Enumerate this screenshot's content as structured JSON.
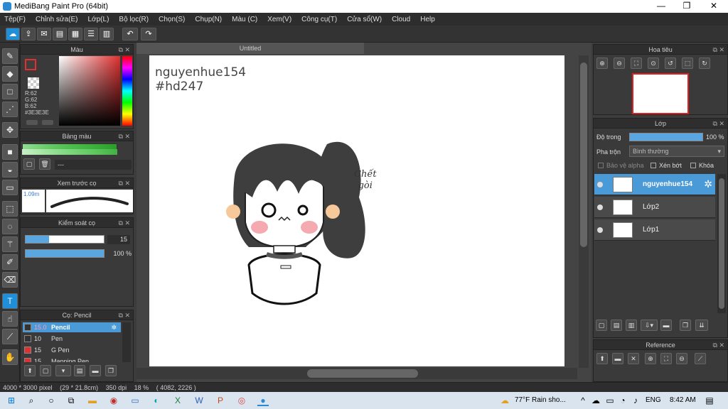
{
  "app": {
    "title": "MediBang Paint Pro (64bit)"
  },
  "window_controls": {
    "minimize": "—",
    "maximize": "❐",
    "close": "✕"
  },
  "menu": [
    "Tệp(F)",
    "Chỉnh sửa(E)",
    "Lớp(L)",
    "Bộ lọc(R)",
    "Chọn(S)",
    "Chụp(N)",
    "Màu (C)",
    "Xem(V)",
    "Công cụ(T)",
    "Cửa sổ(W)",
    "Cloud",
    "Help"
  ],
  "document": {
    "tab_title": "Untitled",
    "canvas_text_line1": "nguyenhue154",
    "canvas_text_line2": "#hd247",
    "sticker_text_1": "Chết",
    "sticker_text_2": "gòi"
  },
  "color_panel": {
    "title": "Màu",
    "r": "R:62",
    "g": "G:62",
    "b": "B:62",
    "hex": "#3E3E3E",
    "accent": "#e03030"
  },
  "palette_panel": {
    "title": "Bảng màu",
    "label": "---"
  },
  "brush_preview": {
    "title": "Xem trước cọ",
    "size": "1.09m"
  },
  "brush_control": {
    "title": "Kiểm soát cọ",
    "size_value": "15",
    "opacity_value": "100 %"
  },
  "brush_list": {
    "title": "Cọ: Pencil",
    "items": [
      {
        "size": "15.0",
        "name": "Pencil",
        "color": "#333333"
      },
      {
        "size": "10",
        "name": "Pen",
        "color": "#333333"
      },
      {
        "size": "15",
        "name": "G Pen",
        "color": "#e03030"
      },
      {
        "size": "15",
        "name": "Mapping Pen",
        "color": "#e03030"
      }
    ]
  },
  "navigator": {
    "title": "Hoa tiêu"
  },
  "layer_panel": {
    "title": "Lớp",
    "opacity_label": "Độ trong",
    "opacity_value": "100 %",
    "blend_label": "Pha trộn",
    "blend_value": "Bình thường",
    "protect_alpha": "Bảo vệ alpha",
    "clipping": "Xén bớt",
    "lock": "Khóa",
    "layers": [
      {
        "name": "nguyenhue154",
        "selected": true
      },
      {
        "name": "Lớp2",
        "selected": false
      },
      {
        "name": "Lớp1",
        "selected": false
      }
    ]
  },
  "reference_panel": {
    "title": "Reference"
  },
  "status": {
    "size": "4000 * 3000 pixel",
    "dimensions": "(29 * 21.8cm)",
    "dpi": "350 dpi",
    "zoom": "18 %",
    "coords": "( 4082, 2226 )"
  },
  "taskbar": {
    "weather": "77°F  Rain sho...",
    "lang": "ENG",
    "time": "8:42 AM"
  }
}
